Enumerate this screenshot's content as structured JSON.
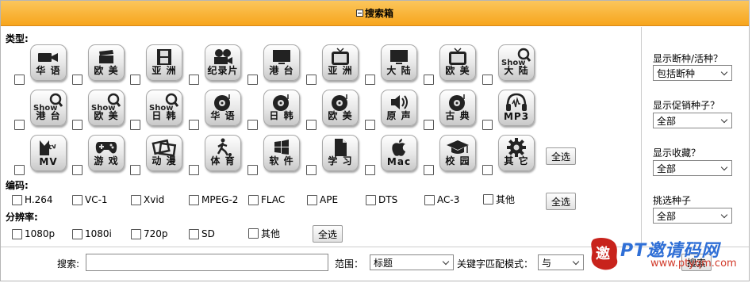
{
  "header": {
    "title": "搜索箱"
  },
  "sections": {
    "type": "类型:",
    "codec": "编码:",
    "resolution": "分辨率:"
  },
  "categories": [
    {
      "label": "华 语",
      "icon": "video-camera-icon"
    },
    {
      "label": "欧 美",
      "icon": "clapperboard-icon"
    },
    {
      "label": "亚 洲",
      "icon": "film-strip-icon"
    },
    {
      "label": "纪录片",
      "icon": "camcorder-icon"
    },
    {
      "label": "港 台",
      "icon": "monitor-icon"
    },
    {
      "label": "亚 洲",
      "icon": "tv-set-icon"
    },
    {
      "label": "大 陆",
      "icon": "monitor-icon"
    },
    {
      "label": "欧 美",
      "icon": "tv-set-icon"
    },
    {
      "label": "大 陆",
      "icon": "show-magnifier-icon",
      "badge": "Show"
    },
    {
      "label": "港 台",
      "icon": "show-magnifier-icon",
      "badge": "Show"
    },
    {
      "label": "欧 美",
      "icon": "show-magnifier-icon",
      "badge": "Show"
    },
    {
      "label": "日 韩",
      "icon": "show-magnifier-icon",
      "badge": "Show"
    },
    {
      "label": "华 语",
      "icon": "music-disc-icon"
    },
    {
      "label": "日 韩",
      "icon": "music-disc-icon"
    },
    {
      "label": "欧 美",
      "icon": "music-disc-icon"
    },
    {
      "label": "原 声",
      "icon": "speaker-icon"
    },
    {
      "label": "古 典",
      "icon": "music-disc-icon"
    },
    {
      "label": "MP3",
      "icon": "headphones-icon"
    },
    {
      "label": "MV",
      "icon": "mtv-icon"
    },
    {
      "label": "游 戏",
      "icon": "gamepad-icon"
    },
    {
      "label": "动 漫",
      "icon": "photo-frames-icon"
    },
    {
      "label": "体 育",
      "icon": "soccer-player-icon"
    },
    {
      "label": "软 件",
      "icon": "windows-logo-icon"
    },
    {
      "label": "学 习",
      "icon": "document-icon"
    },
    {
      "label": "Mac",
      "icon": "apple-logo-icon"
    },
    {
      "label": "校 园",
      "icon": "graduation-cap-icon"
    },
    {
      "label": "其 它",
      "icon": "gear-icon"
    }
  ],
  "select_all": "全选",
  "codecs": [
    "H.264",
    "VC-1",
    "Xvid",
    "MPEG-2",
    "FLAC",
    "APE",
    "DTS",
    "AC-3",
    "其他"
  ],
  "resolutions": [
    "1080p",
    "1080i",
    "720p",
    "SD",
    "其他"
  ],
  "right_panel": {
    "dead": {
      "label": "显示断种/活种？",
      "value": "包括断种"
    },
    "promo": {
      "label": "显示促销种子？",
      "value": "全部"
    },
    "bookmark": {
      "label": "显示收藏？",
      "value": "全部"
    },
    "pick": {
      "label": "挑选种子",
      "value": "全部"
    }
  },
  "search": {
    "label": "搜索:",
    "value": "",
    "scope_label": "范围：",
    "scope_value": "标题",
    "mode_label": "关键字匹配模式：",
    "mode_value": "与",
    "button": "搜索"
  },
  "watermark": {
    "text": "PT邀请码网",
    "url": "www.ptyqm.com",
    "logo_char": "邀"
  }
}
